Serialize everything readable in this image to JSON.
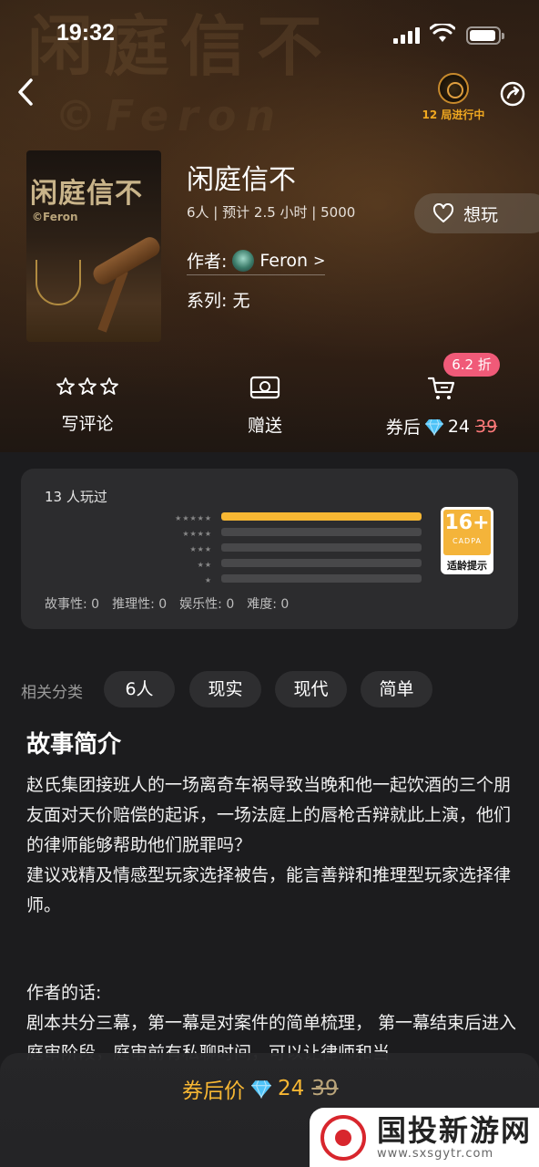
{
  "status": {
    "time": "19:32"
  },
  "header": {
    "active_badge": "12 局进行中"
  },
  "hero_watermark": "闲庭信不",
  "hero_brand": "©Feron",
  "cover": {
    "title": "闲庭信不",
    "brand": "©Feron"
  },
  "game": {
    "title": "闲庭信不",
    "meta": "6人 | 预计 2.5 小时 | 5000",
    "author_label": "作者:",
    "author_name": "Feron",
    "author_chevron": ">",
    "series": "系列: 无",
    "want_label": "想玩"
  },
  "actions": {
    "review_label": "写评论",
    "gift_label": "赠送",
    "buy_prefix": "券后",
    "price_now": "24",
    "price_orig": "39",
    "discount": "6.2 折"
  },
  "rating": {
    "played": "13 人玩过",
    "star_rows": [
      "★★★★★",
      "★★★★",
      "★★★",
      "★★",
      "★"
    ],
    "distribution": [
      1.0,
      0,
      0,
      0,
      0
    ],
    "scores": [
      "故事性: 0",
      "推理性: 0",
      "娱乐性: 0",
      "难度: 0"
    ],
    "age": {
      "num": "16+",
      "org": "CADPA",
      "tip": "适龄提示"
    }
  },
  "tags": {
    "label": "相关分类",
    "items": [
      "6人",
      "现实",
      "现代",
      "简单"
    ]
  },
  "intro": {
    "title": "故事简介",
    "body": "赵氏集团接班人的一场离奇车祸导致当晚和他一起饮酒的三个朋友面对天价赔偿的起诉，一场法庭上的唇枪舌辩就此上演，他们的律师能够帮助他们脱罪吗？\n建议戏精及情感型玩家选择被告，能言善辩和推理型玩家选择律师。",
    "author_words": "作者的话:\n剧本共分三幕，第一幕是对案件的简单梳理， 第一幕结束后进入庭审阶段，庭审前有私聊时间，可以让律师和当"
  },
  "bottom": {
    "label": "券后价",
    "price_now": "24",
    "price_orig": "39"
  },
  "watermark": {
    "main": "国投新游网",
    "sub": "www.sxsgytr.com"
  },
  "colors": {
    "accent": "#f7b733",
    "discount": "#f05a78",
    "diamond": "#4fc3f7"
  }
}
